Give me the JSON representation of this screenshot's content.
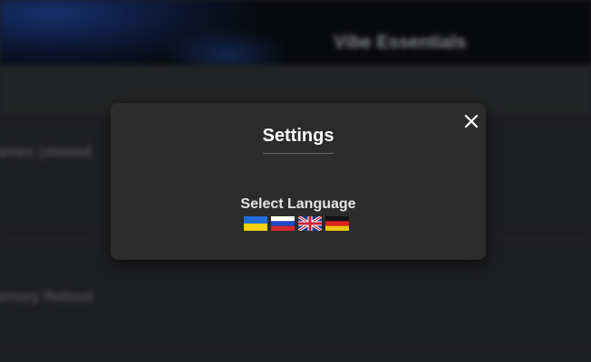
{
  "background": {
    "app_title": "Vibe Essentials",
    "row_1_label": "ames (slowed",
    "row_2_label": "emory Reboot"
  },
  "modal": {
    "title": "Settings",
    "close_icon": "close-icon",
    "language_label": "Select Language",
    "languages": [
      {
        "name": "Ukrainian",
        "icon": "ukraine-flag-icon"
      },
      {
        "name": "Russian",
        "icon": "russia-flag-icon"
      },
      {
        "name": "English",
        "icon": "uk-flag-icon"
      },
      {
        "name": "German",
        "icon": "germany-flag-icon"
      }
    ]
  },
  "colors": {
    "page_background": "#222325",
    "modal_background": "#2c2c2c",
    "title_text": "#ffffff"
  }
}
